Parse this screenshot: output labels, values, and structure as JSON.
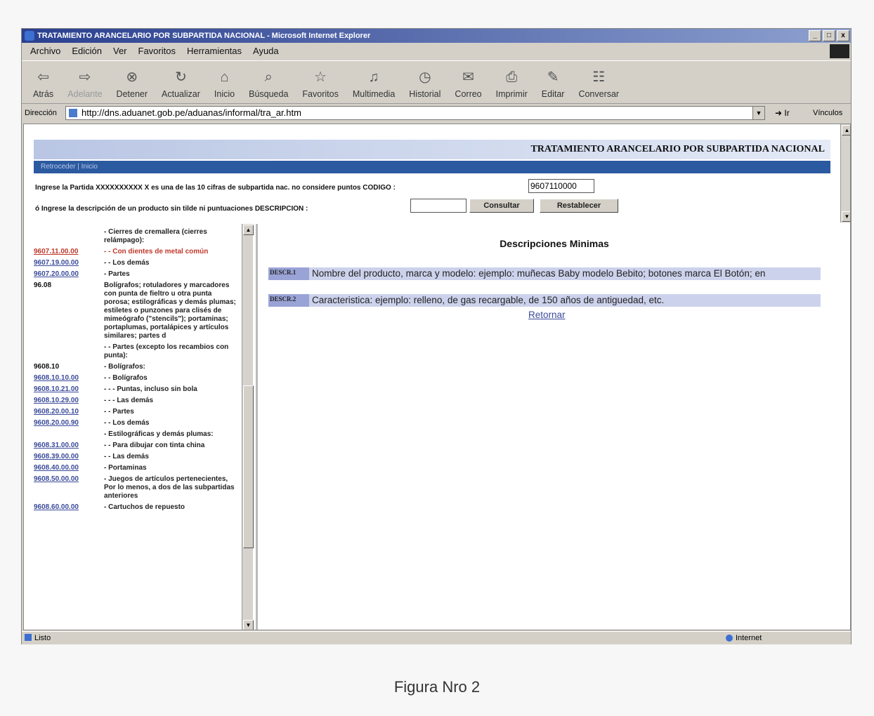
{
  "window": {
    "title": "TRATAMIENTO ARANCELARIO POR SUBPARTIDA NACIONAL - Microsoft Internet Explorer",
    "controls": [
      "_",
      "□",
      "x"
    ]
  },
  "menu": [
    "Archivo",
    "Edición",
    "Ver",
    "Favoritos",
    "Herramientas",
    "Ayuda"
  ],
  "toolbar": [
    {
      "label": "Atrás",
      "icon": "back-arrow-icon",
      "glyph": "⇦",
      "disabled": false
    },
    {
      "label": "Adelante",
      "icon": "forward-arrow-icon",
      "glyph": "⇨",
      "disabled": true
    },
    {
      "label": "Detener",
      "icon": "stop-icon",
      "glyph": "⊗",
      "disabled": false
    },
    {
      "label": "Actualizar",
      "icon": "refresh-icon",
      "glyph": "↻",
      "disabled": false
    },
    {
      "label": "Inicio",
      "icon": "home-icon",
      "glyph": "⌂",
      "disabled": false
    },
    {
      "label": "Búsqueda",
      "icon": "search-icon",
      "glyph": "⌕",
      "disabled": false
    },
    {
      "label": "Favoritos",
      "icon": "favorites-icon",
      "glyph": "☆",
      "disabled": false
    },
    {
      "label": "Multimedia",
      "icon": "media-icon",
      "glyph": "♫",
      "disabled": false
    },
    {
      "label": "Historial",
      "icon": "history-icon",
      "glyph": "◷",
      "disabled": false
    },
    {
      "label": "Correo",
      "icon": "mail-icon",
      "glyph": "✉",
      "disabled": false
    },
    {
      "label": "Imprimir",
      "icon": "print-icon",
      "glyph": "⎙",
      "disabled": false
    },
    {
      "label": "Editar",
      "icon": "edit-icon",
      "glyph": "✎",
      "disabled": false
    },
    {
      "label": "Conversar",
      "icon": "discuss-icon",
      "glyph": "☷",
      "disabled": false
    }
  ],
  "address": {
    "label": "Dirección",
    "url": "http://dns.aduanet.gob.pe/aduanas/informal/tra_ar.htm",
    "go": "Ir",
    "links": "Vínculos"
  },
  "page": {
    "banner": "TRATAMIENTO ARANCELARIO POR SUBPARTIDA NACIONAL",
    "nav": "Retroceder | Inicio",
    "codigo_prompt": "Ingrese la Partida XXXXXXXXXX X es una de las 10 cifras de subpartida nac. no considere puntos CODIGO :",
    "codigo_value": "9607110000",
    "desc_prompt": "ó Ingrese la descripción de un producto sin tilde ni puntuaciones DESCRIPCION :",
    "desc_value": "",
    "consultar": "Consultar",
    "restablecer": "Restablecer"
  },
  "tree": [
    {
      "code": "",
      "desc": "- Cierres de cremallera (cierres relámpago):",
      "type": "plain"
    },
    {
      "code": "9607.11.00.00",
      "desc": "- - Con dientes de metal común",
      "type": "sel"
    },
    {
      "code": "9607.19.00.00",
      "desc": "- - Los demás",
      "type": "link"
    },
    {
      "code": "9607.20.00.00",
      "desc": "- Partes",
      "type": "link"
    },
    {
      "code": "96.08",
      "desc": "Bolígrafos; rotuladores y marcadores con punta de fieltro u otra punta porosa; estilográficas y demás plumas; estiletes o punzones para clisés de mimeógrafo (\"stencils\"); portaminas; portaplumas, portalápices y artículos similares; partes d",
      "type": "plain"
    },
    {
      "code": "",
      "desc": "- - Partes (excepto los recambios con punta):",
      "type": "plain"
    },
    {
      "code": "9608.10",
      "desc": "- Bolígrafos:",
      "type": "plain"
    },
    {
      "code": "9608.10.10.00",
      "desc": "- - Bolígrafos",
      "type": "link"
    },
    {
      "code": "9608.10.21.00",
      "desc": "- - - Puntas, incluso sin bola",
      "type": "link"
    },
    {
      "code": "9608.10.29.00",
      "desc": "- - - Las demás",
      "type": "link"
    },
    {
      "code": "9608.20.00.10",
      "desc": "- - Partes",
      "type": "link"
    },
    {
      "code": "9608.20.00.90",
      "desc": "- - Los demás",
      "type": "link"
    },
    {
      "code": "",
      "desc": "- Estilográficas y demás plumas:",
      "type": "plain"
    },
    {
      "code": "9608.31.00.00",
      "desc": "- - Para dibujar con tinta china",
      "type": "link"
    },
    {
      "code": "9608.39.00.00",
      "desc": "- - Las demás",
      "type": "link"
    },
    {
      "code": "9608.40.00.00",
      "desc": "- Portaminas",
      "type": "link"
    },
    {
      "code": "9608.50.00.00",
      "desc": "- Juegos de artículos pertenecientes, Por lo menos, a dos de las subpartidas anteriores",
      "type": "link"
    },
    {
      "code": "9608.60.00.00",
      "desc": "- Cartuchos de repuesto",
      "type": "link"
    }
  ],
  "right": {
    "title": "Descripciones Minimas",
    "rows": [
      {
        "tag": "DESCR.1",
        "text": "Nombre del producto, marca y modelo: ejemplo: muñecas Baby modelo Bebito; botones marca El Botón; en"
      },
      {
        "tag": "DESCR.2",
        "text": "Caracteristica: ejemplo: relleno, de gas recargable, de 150 años de antiguedad, etc."
      }
    ],
    "retornar": "Retornar"
  },
  "status": {
    "text": "Listo",
    "zone": "Internet"
  },
  "caption": "Figura Nro 2"
}
